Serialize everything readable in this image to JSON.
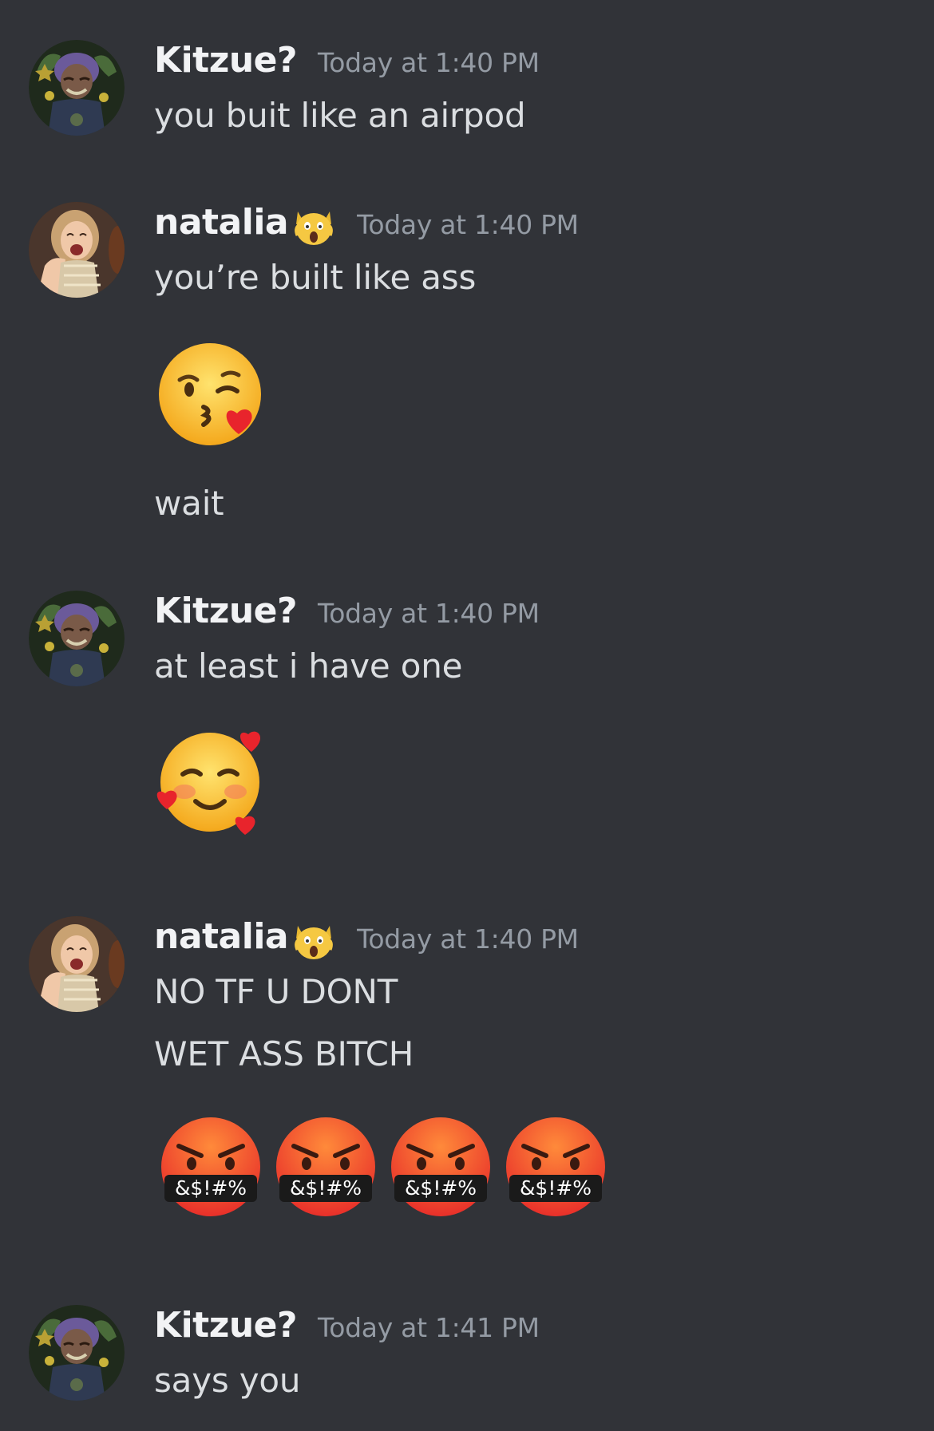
{
  "messages": [
    {
      "author": "Kitzue?",
      "avatar": "kitzue-avatar",
      "timestamp": "Today at 1:40 PM",
      "lines": [
        "you buit like an airpod"
      ]
    },
    {
      "author": "natalia",
      "avatar": "natalia-avatar",
      "badge": "scream-cat-emoji",
      "timestamp": "Today at 1:40 PM",
      "lines": [
        "you’re built like ass",
        "wait"
      ],
      "emoji_lines": [
        "kissing-face-with-heart-emoji"
      ]
    },
    {
      "author": "Kitzue?",
      "avatar": "kitzue-avatar",
      "timestamp": "Today at 1:40 PM",
      "lines": [
        "at least i have one"
      ],
      "emoji_lines": [
        "smiling-face-with-hearts-emoji"
      ]
    },
    {
      "author": "natalia",
      "avatar": "natalia-avatar",
      "badge": "scream-cat-emoji",
      "timestamp": "Today at 1:40 PM",
      "lines": [
        "NO TF U DONT",
        "WET ASS BITCH"
      ],
      "emoji_lines": [
        "cursing-face-emoji",
        "cursing-face-emoji",
        "cursing-face-emoji",
        "cursing-face-emoji"
      ],
      "cursing_text": "&$!#%"
    },
    {
      "author": "Kitzue?",
      "avatar": "kitzue-avatar",
      "timestamp": "Today at 1:41 PM",
      "lines": [
        "says you"
      ]
    }
  ],
  "colors": {
    "background": "#313338",
    "username": "#f2f3f5",
    "timestamp": "#949ba4",
    "message_text": "#dbdee1"
  }
}
